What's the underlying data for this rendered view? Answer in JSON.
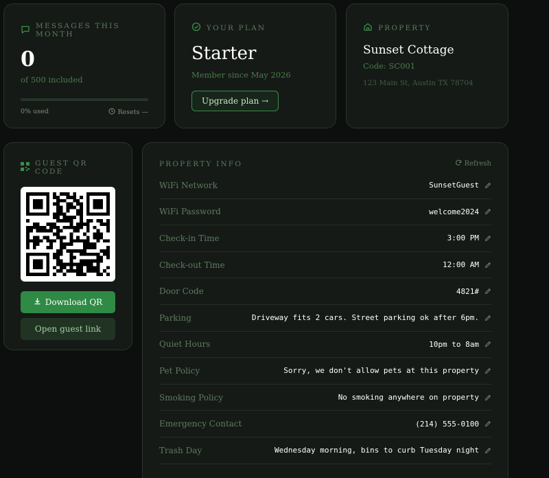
{
  "messages": {
    "heading": "MESSAGES THIS MONTH",
    "count": "0",
    "included": "of 500 included",
    "progress_fraction": 0,
    "used": "0% used",
    "resets": "Resets —"
  },
  "plan": {
    "heading": "YOUR PLAN",
    "name": "Starter",
    "member_since": "Member since May 2026",
    "upgrade_label": "Upgrade plan →"
  },
  "property": {
    "heading": "PROPERTY",
    "name": "Sunset Cottage",
    "code": "Code: SC001",
    "address": "123 Main St, Austin TX 78704"
  },
  "qr": {
    "heading": "GUEST QR CODE",
    "download_label": "Download QR",
    "open_link_label": "Open guest link"
  },
  "info": {
    "heading": "PROPERTY INFO",
    "refresh_label": "Refresh",
    "rows": [
      {
        "label": "WiFi Network",
        "value": "SunsetGuest"
      },
      {
        "label": "WiFi Password",
        "value": "welcome2024"
      },
      {
        "label": "Check-in Time",
        "value": "3:00 PM"
      },
      {
        "label": "Check-out Time",
        "value": "12:00 AM"
      },
      {
        "label": "Door Code",
        "value": "4821#"
      },
      {
        "label": "Parking",
        "value": "Driveway fits 2 cars. Street parking ok after 6pm."
      },
      {
        "label": "Quiet Hours",
        "value": "10pm to 8am"
      },
      {
        "label": "Pet Policy",
        "value": "Sorry, we don't allow pets at this property"
      },
      {
        "label": "Smoking Policy",
        "value": "No smoking anywhere on property"
      },
      {
        "label": "Emergency Contact",
        "value": "(214) 555-0100"
      },
      {
        "label": "Trash Day",
        "value": "Wednesday morning, bins to curb Tuesday night"
      }
    ]
  },
  "colors": {
    "background": "#0c0f0d",
    "card": "#151a16",
    "accent": "#2e8a45",
    "muted_text": "#5f7a5f"
  }
}
